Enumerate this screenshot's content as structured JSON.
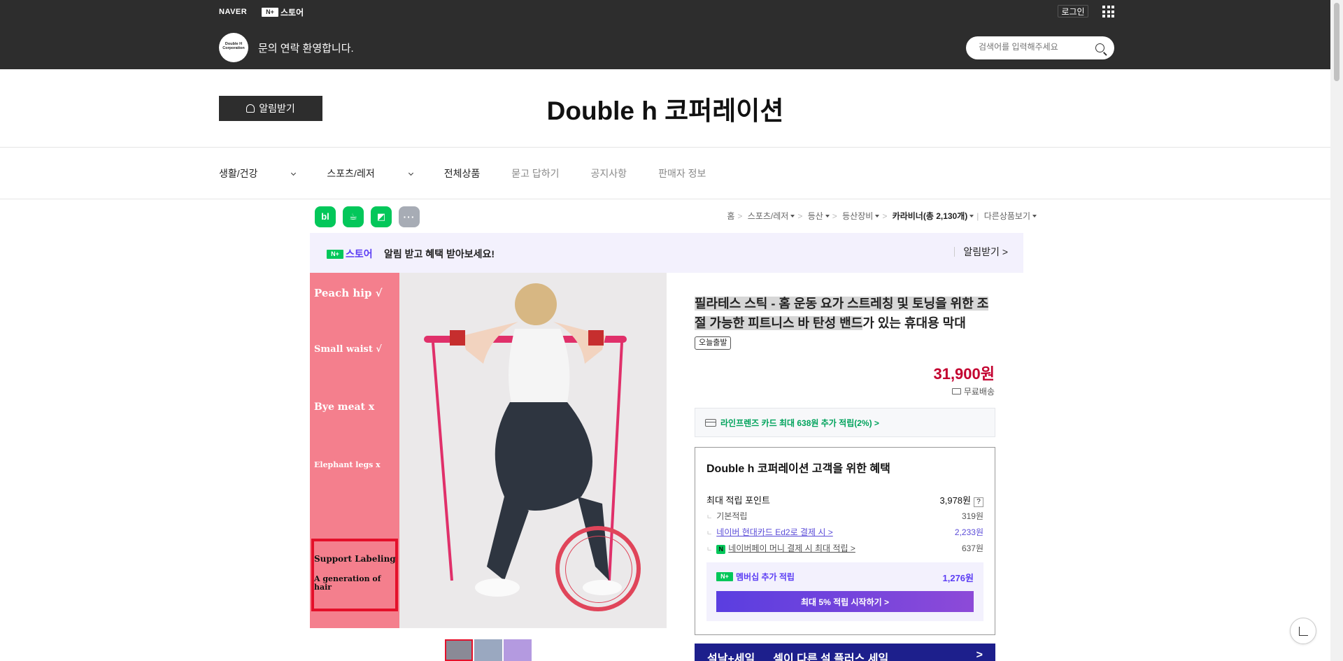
{
  "topbar": {
    "naver": "NAVER",
    "nstore_badge": "N+",
    "nstore_label": "스토어",
    "login": "로그인",
    "logo_text": "Double H Corporation",
    "welcome": "문의 연락 환영합니다.",
    "search_placeholder": "검색어를 입력해주세요"
  },
  "store": {
    "alarm_button": "알림받기",
    "title": "Double h 코퍼레이션"
  },
  "gnb": [
    {
      "label": "생활/건강",
      "dropdown": true
    },
    {
      "label": "스포츠/레저",
      "dropdown": true
    },
    {
      "label": "전체상품"
    },
    {
      "label": "묻고 답하기"
    },
    {
      "label": "공지사항"
    },
    {
      "label": "판매자 정보"
    }
  ],
  "share_icons": [
    "blog-icon",
    "talk-icon",
    "bookmark-icon",
    "more-icon"
  ],
  "share_labels": [
    "bl",
    "☕",
    "◩",
    "···"
  ],
  "breadcrumb": {
    "home": "홈",
    "c1": "스포츠/레저",
    "c2": "등산",
    "c3": "등산장비",
    "c4": "카라비너(총 2,130개)",
    "other": "다른상품보기"
  },
  "promo": {
    "badge": "N+",
    "brand": "스토어",
    "text": "알림 받고 혜택 받아보세요!",
    "link": "알림받기 >"
  },
  "image_labels": {
    "l1": "Peach hip  √",
    "l2": "Small waist  √",
    "l3": "Bye meat x",
    "l4": "Elephant legs x",
    "s1": "Support Labeling",
    "s2": "A generation of hair"
  },
  "product": {
    "title_hl": "필라테스 스틱 - 홈 운동 요가 스트레칭 및 토닝을 위한 조절 가능한 피트니스 바 탄성 밴드",
    "title_rest": "가 있는 휴대용 막대",
    "tag": "오늘출발",
    "price": "31,900원",
    "shipping": "무료배송",
    "card_benefit": "라인프렌즈 카드 최대 638원 추가 적립(2%) >"
  },
  "benefit": {
    "heading": "Double h 코퍼레이션 고객을 위한 혜택",
    "max_label": "최대 적립 포인트",
    "max_value": "3,978원",
    "q": "?",
    "basic_label": "기본적립",
    "basic_value": "319원",
    "card_label": "네이버 현대카드 Ed2로 결제 시 >",
    "card_value": "2,233원",
    "pay_badge": "N",
    "pay_label": "네이버페이 머니 결제 시 최대 적립 >",
    "pay_value": "637원",
    "member_badge": "N+",
    "member_label": "멤버십 추가 적립",
    "member_value": "1,276원",
    "member_button": "최대 5% 적립 시작하기 >"
  },
  "sale_banner": {
    "t1": "설날+세일",
    "t2": "셀이 다른 설 플러스 세일",
    "arrow": ">"
  },
  "colors": {
    "topbar": "#2d2d2d",
    "price": "#c3002f",
    "naver_green": "#03c75a",
    "membership_purple": "#5b3df4"
  }
}
